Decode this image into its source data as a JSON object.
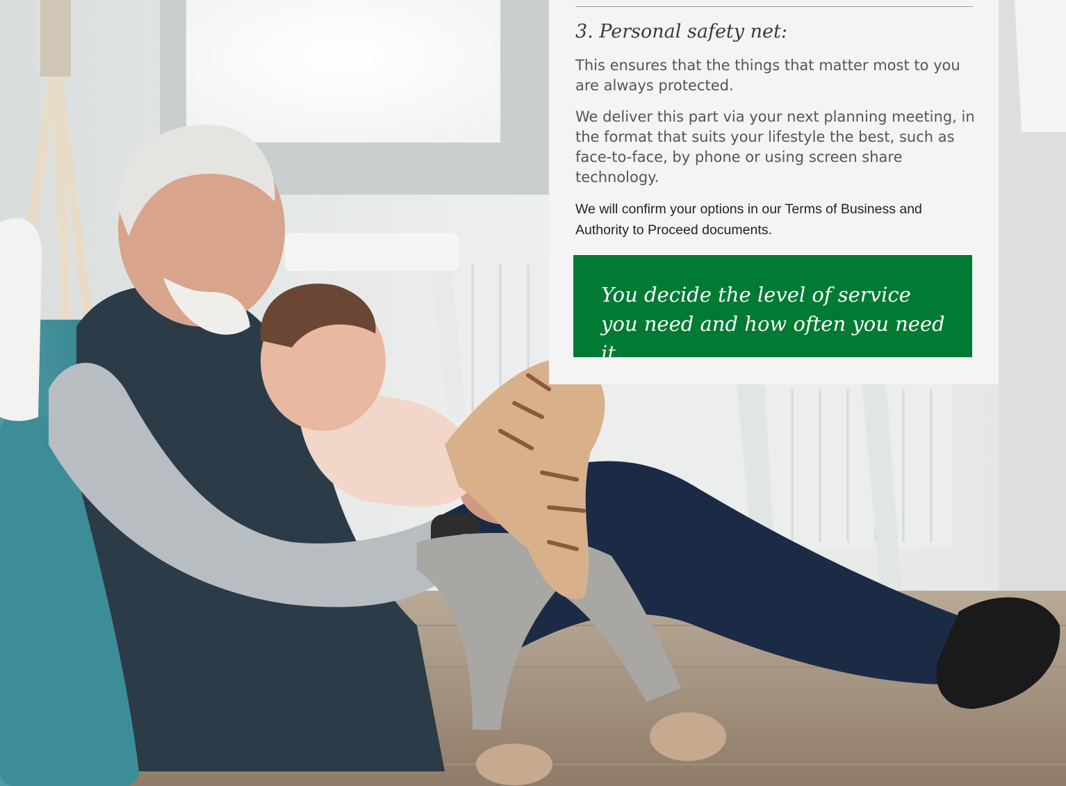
{
  "card": {
    "heading": "3. Personal safety net:",
    "paragraph_1": "This ensures that the things that matter most to you are always protected.",
    "paragraph_2": "We deliver this part via your next planning meeting, in the format that suits your lifestyle the best, such as face-to-face, by phone or using screen share technology.",
    "paragraph_3": "We will confirm your options in our Terms of Business and Authority to Proceed documents.",
    "callout": "You decide the level of service you need and how often you need it.",
    "callout_color": "#017a34"
  }
}
